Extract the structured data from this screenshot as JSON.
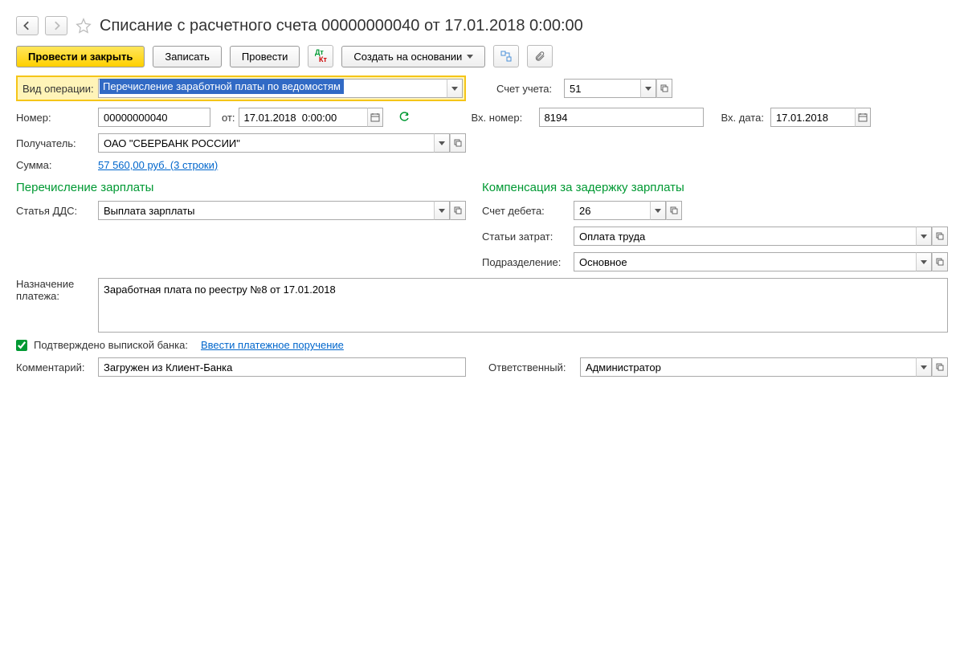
{
  "title": "Списание с расчетного счета 00000000040 от 17.01.2018 0:00:00",
  "toolbar": {
    "post_close": "Провести и закрыть",
    "save": "Записать",
    "post": "Провести",
    "create_based": "Создать на основании"
  },
  "labels": {
    "operation_type": "Вид операции:",
    "account": "Счет учета:",
    "number": "Номер:",
    "from": "от:",
    "in_number": "Вх. номер:",
    "in_date": "Вх. дата:",
    "recipient": "Получатель:",
    "sum": "Сумма:",
    "dds": "Статья ДДС:",
    "debit_account": "Счет дебета:",
    "cost_items": "Статьи затрат:",
    "division": "Подразделение:",
    "purpose": "Назначение платежа:",
    "confirmed": "Подтверждено выпиской банка:",
    "enter_order": "Ввести платежное поручение",
    "comment": "Комментарий:",
    "responsible": "Ответственный:"
  },
  "values": {
    "operation_type": "Перечисление заработной платы по ведомостям",
    "account": "51",
    "number": "00000000040",
    "date": "17.01.2018  0:00:00",
    "in_number": "8194",
    "in_date": "17.01.2018",
    "recipient": "ОАО \"СБЕРБАНК РОССИИ\"",
    "sum": "57 560,00 руб. (3 строки)",
    "dds": "Выплата зарплаты",
    "debit_account": "26",
    "cost_items": "Оплата труда",
    "division": "Основное",
    "purpose": "Заработная плата по реестру №8 от 17.01.2018",
    "comment": "Загружен из Клиент-Банка",
    "responsible": "Администратор"
  },
  "sections": {
    "salary": "Перечисление зарплаты",
    "compensation": "Компенсация за задержку зарплаты"
  }
}
